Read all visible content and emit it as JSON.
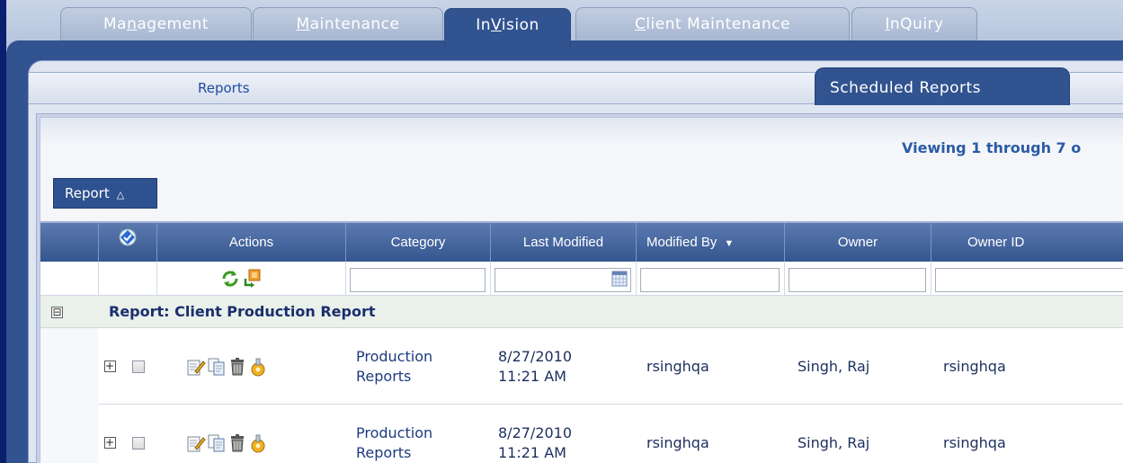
{
  "top_tabs": [
    {
      "pre": "Ma",
      "u": "n",
      "post": "agement"
    },
    {
      "pre": "",
      "u": "M",
      "post": "aintenance"
    },
    {
      "pre": "In",
      "u": "V",
      "post": "ision"
    },
    {
      "pre": "",
      "u": "C",
      "post": "lient Maintenance"
    },
    {
      "pre": "",
      "u": "I",
      "post": "nQuiry"
    }
  ],
  "sub_tabs": {
    "reports": "Reports",
    "scheduled": "Scheduled Reports"
  },
  "viewing_text": "Viewing 1 through 7 o",
  "group_chip": {
    "label": "Report",
    "sort_glyph": "△"
  },
  "columns": {
    "actions": "Actions",
    "category": "Category",
    "last_modified": "Last Modified",
    "modified_by": "Modified By",
    "owner": "Owner",
    "owner_id": "Owner ID"
  },
  "group": {
    "toggle": "⊟",
    "label": "Report: Client Production Report"
  },
  "rows": [
    {
      "category_1": "Production",
      "category_2": "Reports",
      "date": "8/27/2010",
      "time": "11:21 AM",
      "modified_by": "rsinghqa",
      "owner": "Singh, Raj",
      "owner_id": "rsinghqa"
    },
    {
      "category_1": "Production",
      "category_2": "Reports",
      "date": "8/27/2010",
      "time": "11:21 AM",
      "modified_by": "rsinghqa",
      "owner": "Singh, Raj",
      "owner_id": "rsinghqa"
    }
  ],
  "colors": {
    "navy": "#315390",
    "header_blue": "#34558f",
    "link_blue": "#1c3b80",
    "group_bg": "#eaf0ea"
  }
}
